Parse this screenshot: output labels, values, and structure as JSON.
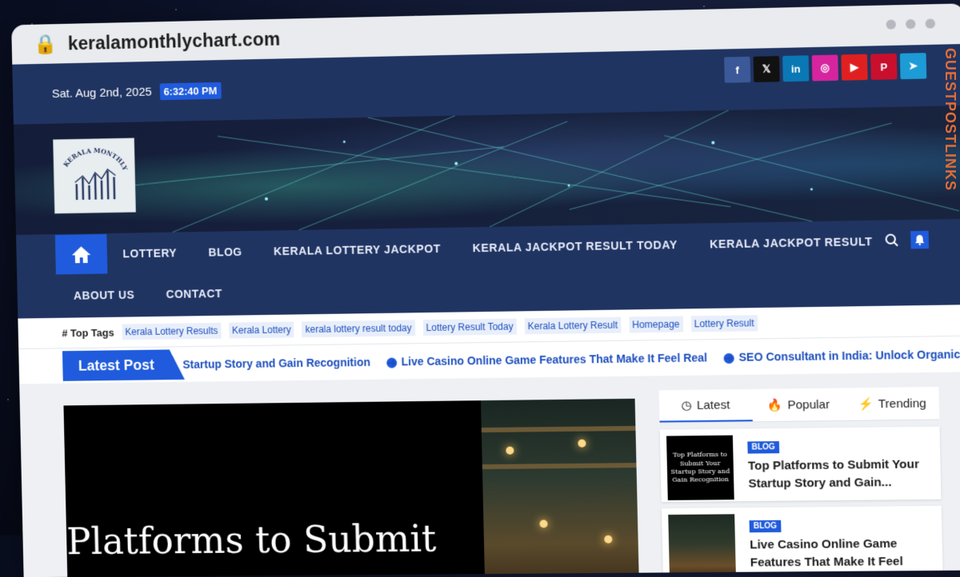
{
  "browser": {
    "url": "keralamonthlychart.com"
  },
  "topbar": {
    "date": "Sat. Aug 2nd, 2025",
    "time": "6:32:40 PM",
    "social": [
      {
        "name": "facebook-icon",
        "glyph": "f",
        "color": "#3b5998"
      },
      {
        "name": "x-twitter-icon",
        "glyph": "𝕏",
        "color": "#111111"
      },
      {
        "name": "linkedin-icon",
        "glyph": "in",
        "color": "#0a78b5"
      },
      {
        "name": "instagram-icon",
        "glyph": "◎",
        "color": "#d6249f"
      },
      {
        "name": "youtube-icon",
        "glyph": "▶",
        "color": "#e02020"
      },
      {
        "name": "pinterest-icon",
        "glyph": "P",
        "color": "#c8102e"
      },
      {
        "name": "telegram-icon",
        "glyph": "➤",
        "color": "#1d9bd6"
      }
    ]
  },
  "logo": {
    "text": "KERALA MONTHLY CHART"
  },
  "nav": {
    "items": [
      "LOTTERY",
      "BLOG",
      "KERALA LOTTERY JACKPOT",
      "KERALA JACKPOT RESULT TODAY",
      "KERALA JACKPOT RESULT"
    ],
    "items2": [
      "ABOUT US",
      "CONTACT"
    ]
  },
  "tags": {
    "label": "Top Tags",
    "items": [
      "Kerala Lottery Results",
      "Kerala Lottery",
      "kerala lottery result today",
      "Lottery Result Today",
      "Kerala Lottery Result",
      "Homepage",
      "Lottery Result"
    ]
  },
  "latest": {
    "label": "Latest Post",
    "ticker": [
      "Startup Story and Gain Recognition",
      "Live Casino Online Game Features That Make It Feel Real",
      "SEO Consultant in India: Unlock Organic G"
    ]
  },
  "hero": {
    "title": "Platforms to Submit"
  },
  "sidebar": {
    "tabs": [
      "Latest",
      "Popular",
      "Trending"
    ],
    "posts": [
      {
        "badge": "BLOG",
        "title": "Top Platforms to Submit Your Startup Story and Gain...",
        "thumb": "Top Platforms to Submit Your Startup Story and Gain Recognition"
      },
      {
        "badge": "BLOG",
        "title": "Live Casino Online Game Features That Make It Feel Real",
        "thumb": ""
      }
    ]
  },
  "watermark": "GUESTPOSTLINKS"
}
